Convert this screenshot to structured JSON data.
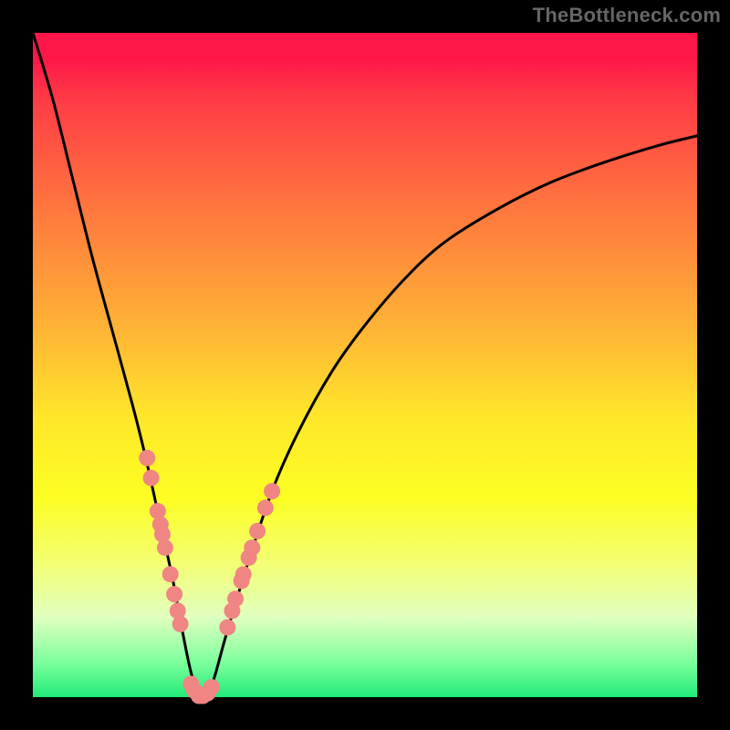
{
  "watermark": "TheBottleneck.com",
  "colors": {
    "curve": "#000000",
    "dots_fill": "#ef8683",
    "dots_stroke": "#cf5e5c",
    "background_black": "#000000"
  },
  "chart_data": {
    "type": "line",
    "title": "",
    "xlabel": "",
    "ylabel": "",
    "xlim": [
      0,
      100
    ],
    "ylim": [
      0,
      100
    ],
    "series": [
      {
        "name": "bottleneck-curve",
        "x": [
          0,
          3,
          6,
          9,
          12,
          15,
          17,
          19,
          21,
          22.5,
          24,
          25.5,
          27,
          29,
          32,
          36,
          40,
          45,
          50,
          56,
          62,
          70,
          78,
          86,
          94,
          100
        ],
        "y": [
          100,
          90,
          78,
          66,
          55,
          44,
          36,
          27,
          18,
          10,
          3,
          0,
          2,
          9,
          19,
          31,
          40,
          49,
          56,
          63,
          68.5,
          73.5,
          77.5,
          80.5,
          83,
          84.5
        ]
      }
    ],
    "scatter": {
      "name": "highlighted-points",
      "points": [
        {
          "x": 17.2,
          "y": 36.0
        },
        {
          "x": 17.8,
          "y": 33.0
        },
        {
          "x": 18.8,
          "y": 28.0
        },
        {
          "x": 19.2,
          "y": 26.0
        },
        {
          "x": 19.5,
          "y": 24.5
        },
        {
          "x": 19.9,
          "y": 22.5
        },
        {
          "x": 20.7,
          "y": 18.5
        },
        {
          "x": 21.3,
          "y": 15.5
        },
        {
          "x": 21.8,
          "y": 13.0
        },
        {
          "x": 22.2,
          "y": 11.0
        },
        {
          "x": 23.8,
          "y": 2.0
        },
        {
          "x": 24.3,
          "y": 1.0
        },
        {
          "x": 25.0,
          "y": 0.2
        },
        {
          "x": 25.6,
          "y": 0.2
        },
        {
          "x": 26.3,
          "y": 0.6
        },
        {
          "x": 26.9,
          "y": 1.5
        },
        {
          "x": 29.3,
          "y": 10.5
        },
        {
          "x": 30.0,
          "y": 13.0
        },
        {
          "x": 30.5,
          "y": 14.8
        },
        {
          "x": 31.4,
          "y": 17.5
        },
        {
          "x": 31.7,
          "y": 18.5
        },
        {
          "x": 32.5,
          "y": 21.0
        },
        {
          "x": 33.0,
          "y": 22.5
        },
        {
          "x": 33.8,
          "y": 25.0
        },
        {
          "x": 35.0,
          "y": 28.5
        },
        {
          "x": 36.0,
          "y": 31.0
        }
      ]
    }
  }
}
